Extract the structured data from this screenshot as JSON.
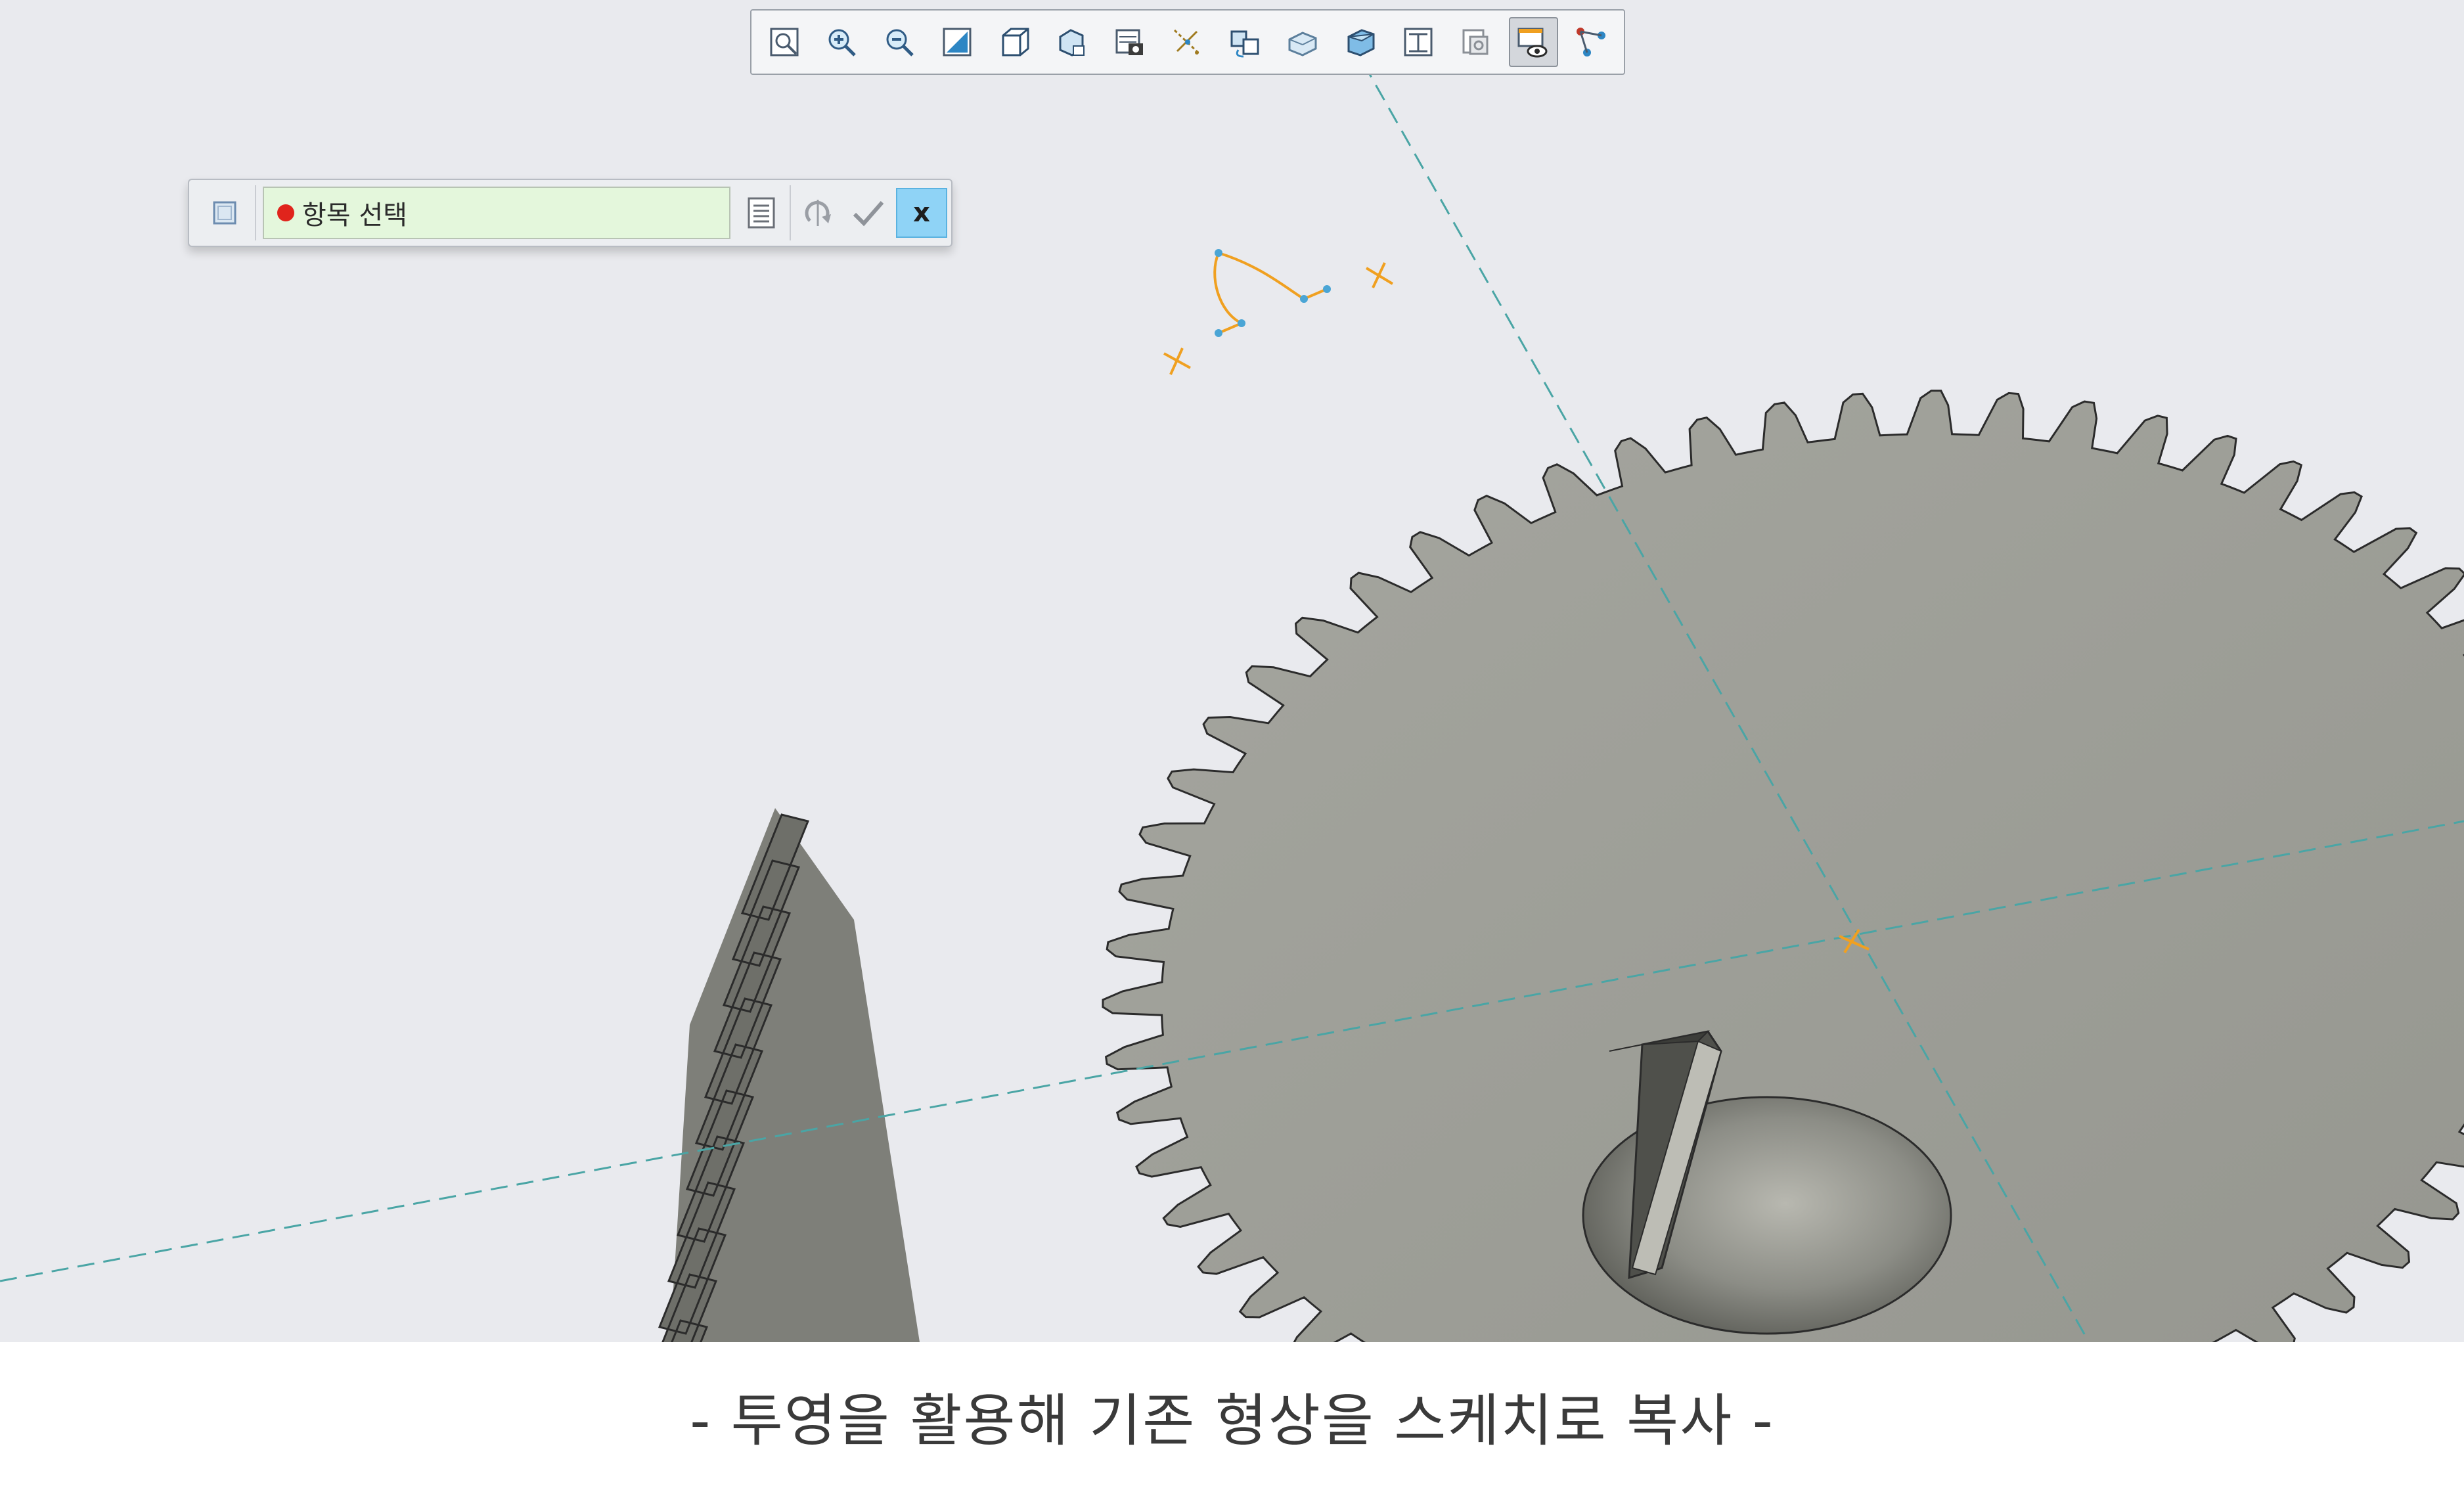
{
  "view_toolbar": {
    "buttons": [
      {
        "name": "refit-icon"
      },
      {
        "name": "zoom-in-icon"
      },
      {
        "name": "zoom-out-icon"
      },
      {
        "name": "repaint-icon"
      },
      {
        "name": "display-style-icon"
      },
      {
        "name": "saved-orientations-icon"
      },
      {
        "name": "view-manager-icon"
      },
      {
        "name": "datum-display-filters-icon"
      },
      {
        "name": "spin-center-icon"
      },
      {
        "name": "annotation-display-icon"
      },
      {
        "name": "perspective-view-icon"
      },
      {
        "name": "appearance-icon"
      },
      {
        "name": "section-view-icon"
      },
      {
        "name": "sketch-view-icon",
        "active": true
      },
      {
        "name": "references-icon"
      }
    ]
  },
  "select_dialog": {
    "field_label": "항목 선택",
    "cancel_label": "x",
    "field_color": "#e4f7dc",
    "status_color": "#e0241c"
  },
  "caption": {
    "text": "- 투영을 활용해 기존 형상을 스케치로 복사 -"
  },
  "colors": {
    "background": "#e9eaee",
    "gear_face": "#9d9e97",
    "centerline": "#4aa5a5",
    "sketch": "#f0a020"
  }
}
